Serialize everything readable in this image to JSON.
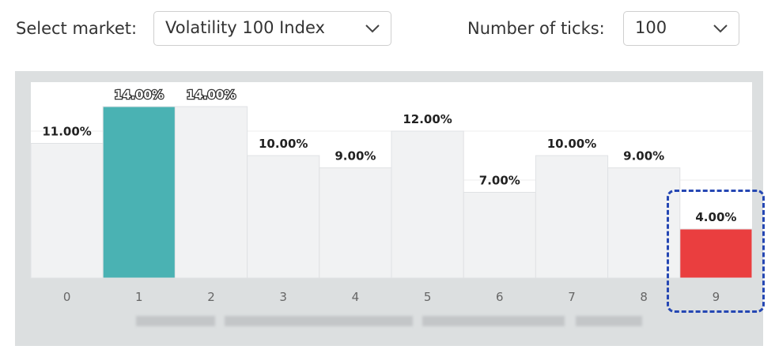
{
  "controls": {
    "market_label": "Select market:",
    "market_value": "Volatility 100 Index",
    "ticks_label": "Number of ticks:",
    "ticks_value": "100"
  },
  "colors": {
    "default_bar": "#f1f2f3",
    "highest_bar": "#4ab2b3",
    "lowest_bar": "#ea3e3f",
    "highlight_border": "#2547b3"
  },
  "chart_data": {
    "type": "bar",
    "categories": [
      "0",
      "1",
      "2",
      "3",
      "4",
      "5",
      "6",
      "7",
      "8",
      "9"
    ],
    "values": [
      11,
      14,
      14,
      10,
      9,
      12,
      7,
      10,
      9,
      4
    ],
    "data_labels": [
      "11.00%",
      "14.00%",
      "14.00%",
      "10.00%",
      "9.00%",
      "12.00%",
      "7.00%",
      "10.00%",
      "9.00%",
      "4.00%"
    ],
    "bar_colors": [
      "#f1f2f3",
      "#4ab2b3",
      "#f1f2f3",
      "#f1f2f3",
      "#f1f2f3",
      "#f1f2f3",
      "#f1f2f3",
      "#f1f2f3",
      "#f1f2f3",
      "#ea3e3f"
    ],
    "outlined_labels": [
      1,
      2
    ],
    "highlighted_category": "9",
    "title": "",
    "xlabel": "",
    "ylabel": "",
    "ylim": [
      0,
      16
    ],
    "grid": true
  }
}
